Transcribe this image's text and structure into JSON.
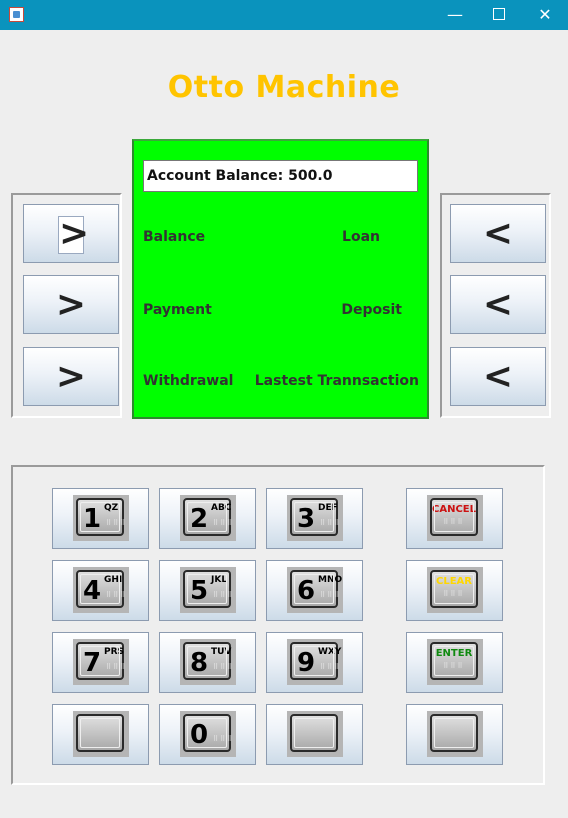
{
  "window": {
    "minimize": "—",
    "maximize": "",
    "close": "✕"
  },
  "app": {
    "title": "Otto Machine"
  },
  "screen": {
    "account_balance": "Account Balance: 500.0",
    "options": {
      "left": [
        "Balance",
        "Payment",
        "Withdrawal"
      ],
      "right": [
        "Loan",
        "Deposit",
        "Lastest Trannsaction"
      ]
    }
  },
  "side_buttons": {
    "left_symbol": ">",
    "right_symbol": "<"
  },
  "keypad": {
    "keys": [
      {
        "num": "1",
        "letters": "QZ"
      },
      {
        "num": "2",
        "letters": "ABC"
      },
      {
        "num": "3",
        "letters": "DEF"
      },
      {
        "num": "4",
        "letters": "GHI"
      },
      {
        "num": "5",
        "letters": "JKL"
      },
      {
        "num": "6",
        "letters": "MNO"
      },
      {
        "num": "7",
        "letters": "PRS"
      },
      {
        "num": "8",
        "letters": "TUV"
      },
      {
        "num": "9",
        "letters": "WXY"
      },
      {
        "num": "0",
        "letters": ""
      }
    ],
    "cancel": "CANCEL",
    "clear": "CLEAR",
    "enter": "ENTER",
    "braille": "⠿⠿⠿"
  },
  "colors": {
    "title": "#ffc400",
    "screen": "#00ff00",
    "cancel": "#cc1111",
    "clear": "#ffd700",
    "enter": "#108a10",
    "titlebar": "#0a93bd"
  }
}
